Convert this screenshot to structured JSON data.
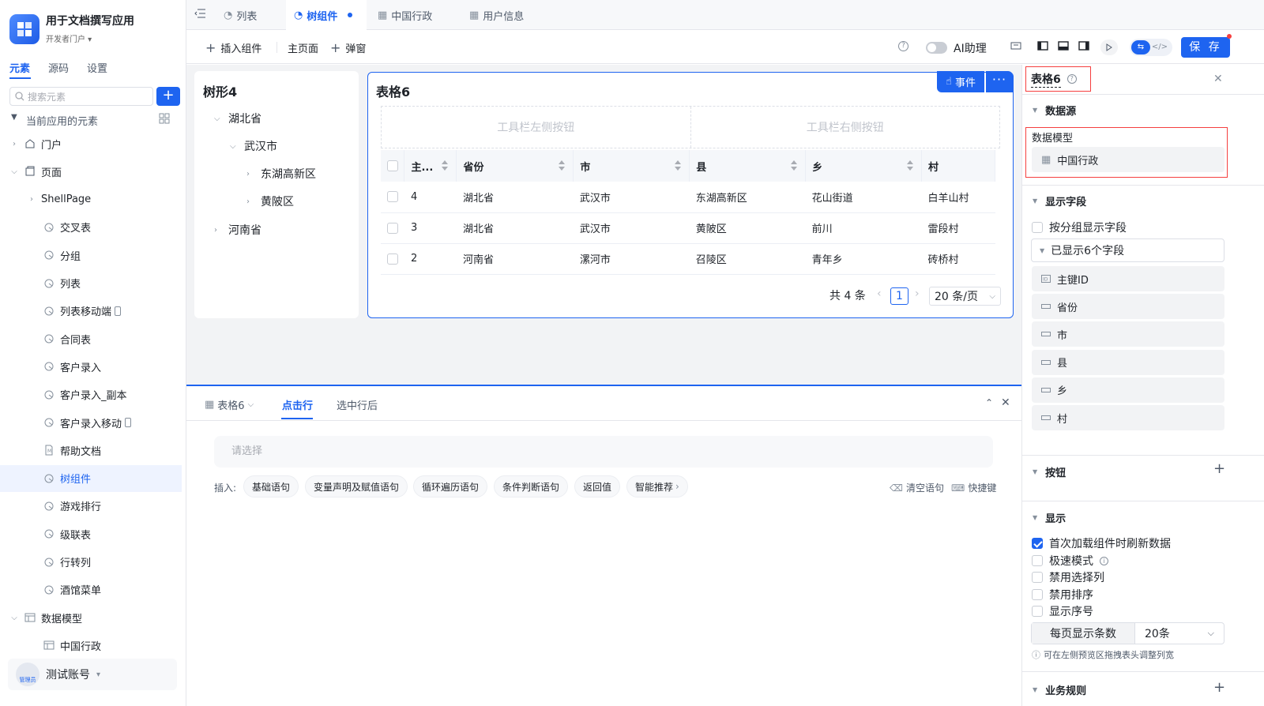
{
  "app": {
    "title": "用于文档撰写应用",
    "portal": "开发者门户"
  },
  "left_tabs": [
    "元素",
    "源码",
    "设置"
  ],
  "search": {
    "placeholder": "搜索元素"
  },
  "tree_header": "当前应用的元素",
  "sidebar": {
    "items": [
      {
        "label": "门户",
        "icon": "home-icon",
        "level": 1,
        "arrow": "right"
      },
      {
        "label": "页面",
        "icon": "page-icon",
        "level": 1,
        "arrow": "down"
      },
      {
        "label": "ShellPage",
        "icon": "",
        "level": 2,
        "arrow": "right"
      },
      {
        "label": "交叉表",
        "icon": "page-item-icon",
        "level": 3
      },
      {
        "label": "分组",
        "icon": "page-item-icon",
        "level": 3
      },
      {
        "label": "列表",
        "icon": "page-item-icon",
        "level": 3
      },
      {
        "label": "列表移动端",
        "icon": "page-item-icon",
        "level": 3,
        "mobile": true
      },
      {
        "label": "合同表",
        "icon": "page-item-icon",
        "level": 3
      },
      {
        "label": "客户录入",
        "icon": "page-item-icon",
        "level": 3
      },
      {
        "label": "客户录入_副本",
        "icon": "page-item-icon",
        "level": 3
      },
      {
        "label": "客户录入移动",
        "icon": "page-item-icon",
        "level": 3,
        "mobile": true
      },
      {
        "label": "帮助文档",
        "icon": "doc-icon",
        "level": 3
      },
      {
        "label": "树组件",
        "icon": "page-item-icon",
        "level": 3,
        "selected": true
      },
      {
        "label": "游戏排行",
        "icon": "page-item-icon",
        "level": 3
      },
      {
        "label": "级联表",
        "icon": "page-item-icon",
        "level": 3
      },
      {
        "label": "行转列",
        "icon": "page-item-icon",
        "level": 3
      },
      {
        "label": "酒馆菜单",
        "icon": "page-item-icon",
        "level": 3
      },
      {
        "label": "数据模型",
        "icon": "table-icon",
        "level": 1,
        "arrow": "down"
      },
      {
        "label": "中国行政",
        "icon": "table-icon",
        "level": 3
      }
    ]
  },
  "account": {
    "name": "测试账号",
    "role": "管理员"
  },
  "tabs": [
    {
      "label": "列表",
      "icon": "page-item-icon"
    },
    {
      "label": "树组件",
      "icon": "page-item-icon",
      "active": true
    },
    {
      "label": "中国行政",
      "icon": "table-icon"
    },
    {
      "label": "用户信息",
      "icon": "table-icon"
    }
  ],
  "toolbar": {
    "insert": "插入组件",
    "main_page": "主页面",
    "popup": "弹窗",
    "ai_label": "AI助理",
    "save": "保 存"
  },
  "tree_card": {
    "title": "树形4",
    "nodes": [
      "湖北省",
      "武汉市",
      "东湖高新区",
      "黄陂区",
      "河南省"
    ]
  },
  "table_card": {
    "title": "表格6",
    "event_btn": "事件",
    "toolbar_left": "工具栏左侧按钮",
    "toolbar_right": "工具栏右侧按钮",
    "columns": [
      "主...",
      "省份",
      "市",
      "县",
      "乡",
      "村"
    ],
    "rows": [
      [
        "4",
        "湖北省",
        "武汉市",
        "东湖高新区",
        "花山街道",
        "白羊山村"
      ],
      [
        "3",
        "湖北省",
        "武汉市",
        "黄陂区",
        "前川",
        "雷段村"
      ],
      [
        "2",
        "河南省",
        "漯河市",
        "召陵区",
        "青年乡",
        "砖桥村"
      ]
    ],
    "total": "共 4 条",
    "page": "1",
    "page_size": "20 条/页"
  },
  "bottom": {
    "component": "表格6",
    "tab_click": "点击行",
    "tab_after": "选中行后",
    "select_placeholder": "请选择",
    "insert_label": "插入:",
    "chips": [
      "基础语句",
      "变量声明及赋值语句",
      "循环遍历语句",
      "条件判断语句",
      "返回值",
      "智能推荐"
    ],
    "clear": "清空语句",
    "shortcut": "快捷键"
  },
  "right": {
    "title": "表格6",
    "sec_datasource": "数据源",
    "data_model_label": "数据模型",
    "data_model_value": "中国行政",
    "sec_fields": "显示字段",
    "group_fields": "按分组显示字段",
    "shown_fields": "已显示6个字段",
    "fields": [
      {
        "label": "主键ID",
        "icon": "id-icon"
      },
      {
        "label": "省份",
        "icon": "text-field-icon"
      },
      {
        "label": "市",
        "icon": "text-field-icon"
      },
      {
        "label": "县",
        "icon": "text-field-icon"
      },
      {
        "label": "乡",
        "icon": "text-field-icon"
      },
      {
        "label": "村",
        "icon": "text-field-icon"
      }
    ],
    "sec_buttons": "按钮",
    "sec_display": "显示",
    "checks": [
      {
        "label": "首次加载组件时刷新数据",
        "checked": true
      },
      {
        "label": "极速模式",
        "checked": false,
        "info": true
      },
      {
        "label": "禁用选择列",
        "checked": false
      },
      {
        "label": "禁用排序",
        "checked": false
      },
      {
        "label": "显示序号",
        "checked": false
      }
    ],
    "per_page_label": "每页显示条数",
    "per_page_value": "20条",
    "hint": "可在左侧预览区拖拽表头调整列宽",
    "sec_rules": "业务规则"
  },
  "colors": {
    "accent": "#1e64f0",
    "highlight_border": "#f53f3f"
  }
}
